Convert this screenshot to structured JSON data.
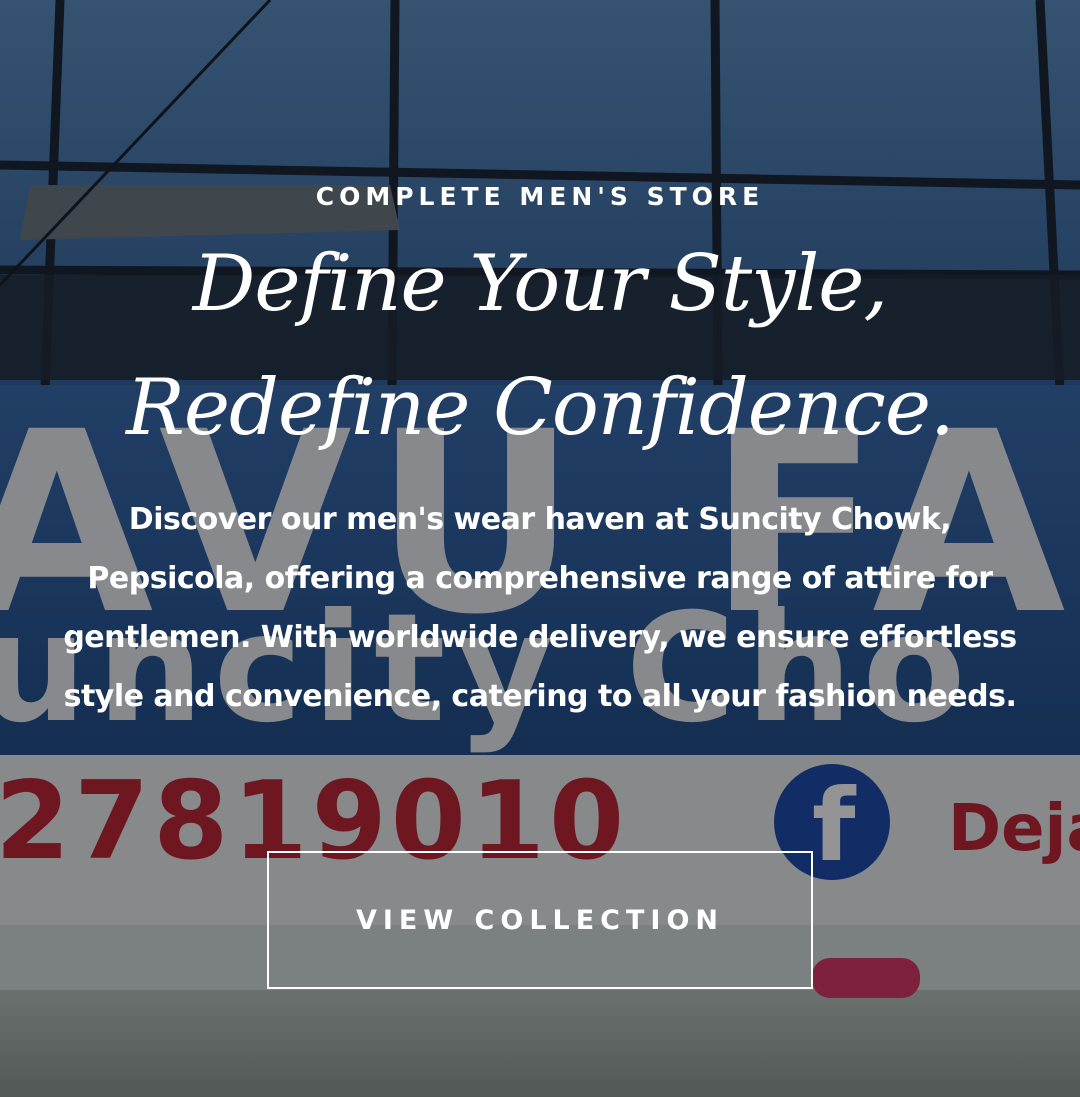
{
  "hero": {
    "eyebrow": "COMPLETE MEN'S STORE",
    "headline_line1": "Define Your Style,",
    "headline_line2": "Redefine Confidence.",
    "description": "Discover our men's wear haven at Suncity Chowk, Pepsicola, offering a comprehensive range of attire for gentlemen. With worldwide delivery, we ensure effortless style and convenience, catering to all your fashion needs.",
    "cta_label": "VIEW COLLECTION"
  },
  "background": {
    "sign_text": "AVU FAS",
    "sign_subtext": "uncity Cho",
    "phone_text": "27819010",
    "social_text": "Deja",
    "facebook_glyph": "f",
    "icons": [
      "facebook-icon",
      "instagram-icon"
    ],
    "colors": {
      "overlay": "#000000",
      "glass": "#3f6fa8",
      "sign_blue": "#2d5fa6",
      "phone_red": "#c0283a",
      "facebook_blue": "#1f4fb0"
    }
  }
}
